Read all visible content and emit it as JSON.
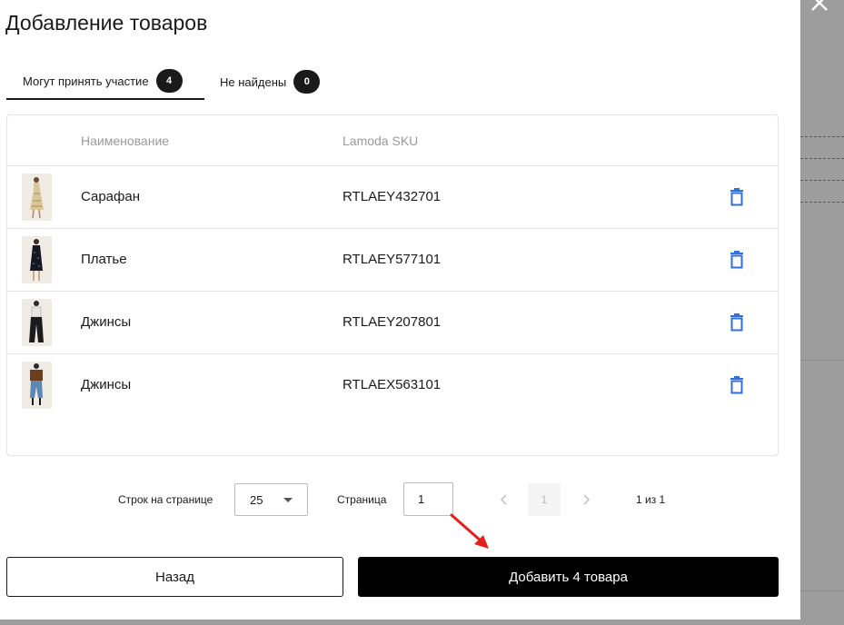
{
  "dialog": {
    "title": "Добавление товаров"
  },
  "tabs": [
    {
      "label": "Могут принять участие",
      "count": "4",
      "active": true
    },
    {
      "label": "Не найдены",
      "count": "0",
      "active": false
    }
  ],
  "table": {
    "columns": [
      "Наименование",
      "Lamoda SKU"
    ],
    "rows": [
      {
        "name": "Сарафан",
        "sku": "RTLAEY432701",
        "thumb": "dress-beige-icon"
      },
      {
        "name": "Платье",
        "sku": "RTLAEY577101",
        "thumb": "dress-black-sequin-icon"
      },
      {
        "name": "Джинсы",
        "sku": "RTLAEY207801",
        "thumb": "jeans-black-icon"
      },
      {
        "name": "Джинсы",
        "sku": "RTLAEX563101",
        "thumb": "jeans-blue-icon"
      }
    ]
  },
  "pagination": {
    "rows_per_page_label": "Строк на странице",
    "rows_per_page_value": "25",
    "page_label": "Страница",
    "page_input_value": "1",
    "current_page": "1",
    "page_of": "1 из 1"
  },
  "buttons": {
    "back": "Назад",
    "add": "Добавить 4 товара"
  },
  "colors": {
    "accent_blue": "#2f6fde",
    "primary_black": "#000000",
    "annotation_red": "#e3201b"
  }
}
